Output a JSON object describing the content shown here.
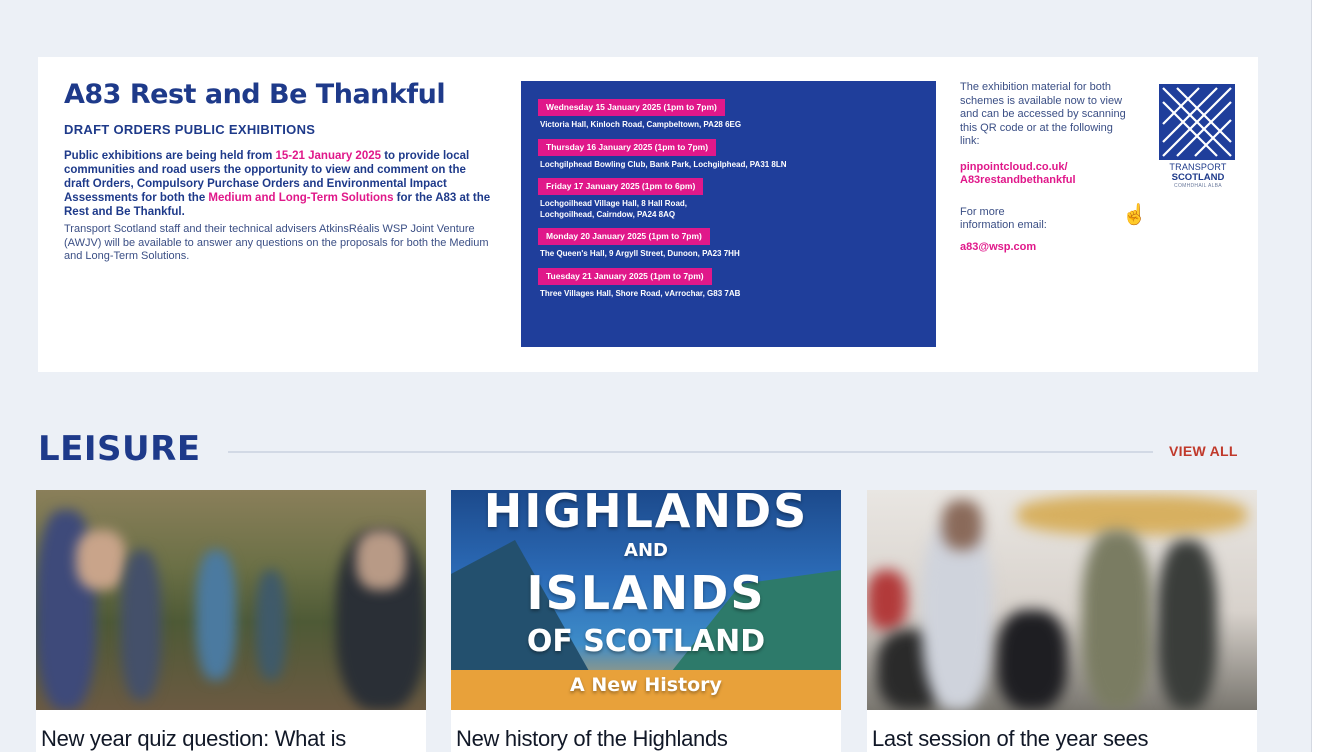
{
  "banner": {
    "title": "A83 Rest and Be Thankful",
    "subtitle": "DRAFT ORDERS PUBLIC EXHIBITIONS",
    "para1_a": "Public exhibitions are being held from ",
    "para1_dates": "15-21 January 2025",
    "para1_b": " to provide local communities and road users the opportunity to view and comment on the draft Orders, Compulsory Purchase Orders and Environmental Impact Assessments for both the ",
    "para1_solutions": "Medium and Long-Term Solutions",
    "para1_c": " for the A83 at the Rest and Be Thankful.",
    "para2": "Transport Scotland staff and their technical advisers AtkinsRéalis WSP Joint Venture (AWJV) will be available to answer any questions on the proposals for both the Medium and Long-Term Solutions.",
    "exhibitions": [
      {
        "date": "Wednesday 15 January 2025 (1pm to 7pm)",
        "venue": "Victoria Hall, Kinloch Road, Campbeltown, PA28 6EG"
      },
      {
        "date": "Thursday 16 January 2025 (1pm to 7pm)",
        "venue": "Lochgilphead Bowling Club, Bank Park, Lochgilphead, PA31 8LN"
      },
      {
        "date": "Friday 17 January 2025 (1pm to 6pm)",
        "venue": "Lochgoilhead Village Hall, 8 Hall Road,\nLochgoilhead, Cairndow, PA24 8AQ"
      },
      {
        "date": "Monday 20 January 2025 (1pm to 7pm)",
        "venue": "The Queen's Hall, 9 Argyll Street, Dunoon, PA23 7HH"
      },
      {
        "date": "Tuesday 21 January 2025 (1pm to 7pm)",
        "venue": "Three Villages Hall, Shore Road, vArrochar, G83 7AB"
      }
    ],
    "info": "The exhibition material for both schemes is available now to view and can be accessed by scanning this QR code or at the following link:",
    "link": "pinpointcloud.co.uk/\nA83restandbethankful",
    "more_info": "For more\ninformation email:",
    "email": "a83@wsp.com",
    "logo": {
      "line1": "TRANSPORT",
      "line2": "SCOTLAND",
      "line3": "COMHDHAIL ALBA"
    }
  },
  "leisure": {
    "title": "LEISURE",
    "view_all": "VIEW ALL",
    "cards": [
      {
        "title": "New year quiz question: What is"
      },
      {
        "title": "New history of the Highlands",
        "cover": {
          "l1": "HIGHLANDS",
          "l2": "AND",
          "l3": "ISLANDS",
          "l4": "OF SCOTLAND",
          "l5": "A New History"
        }
      },
      {
        "title": "Last session of the year sees"
      }
    ]
  },
  "colors": {
    "navy": "#1e3a8a",
    "pink": "#e0188a",
    "panel_blue": "#1f3e9b",
    "view_all_red": "#c0392b",
    "page_bg": "#ecf0f6"
  }
}
